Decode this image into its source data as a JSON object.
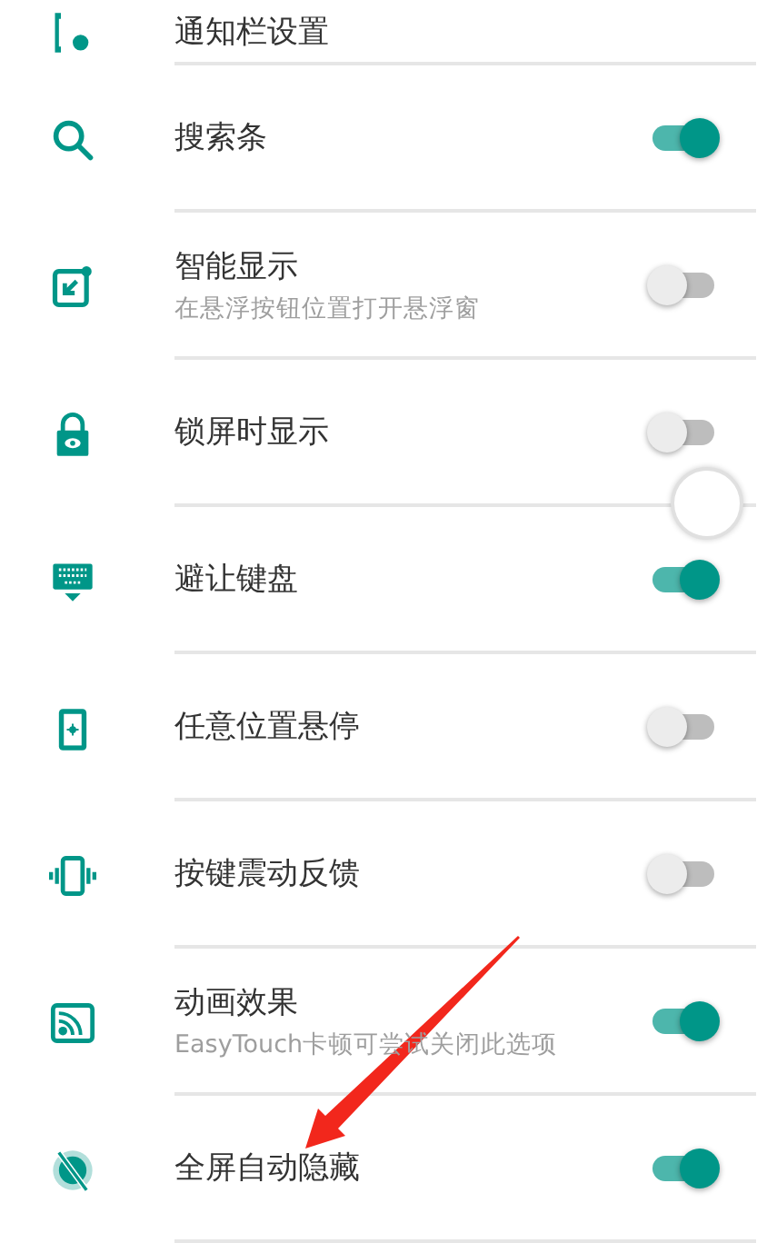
{
  "settings": [
    {
      "kind": "nav",
      "title": "通知栏设置"
    },
    {
      "kind": "toggle",
      "title": "搜索条",
      "on": true
    },
    {
      "kind": "toggle",
      "title": "智能显示",
      "subtitle": "在悬浮按钮位置打开悬浮窗",
      "on": false
    },
    {
      "kind": "toggle",
      "title": "锁屏时显示",
      "on": false
    },
    {
      "kind": "toggle",
      "title": "避让键盘",
      "on": true
    },
    {
      "kind": "toggle",
      "title": "任意位置悬停",
      "on": false
    },
    {
      "kind": "toggle",
      "title": "按键震动反馈",
      "on": false
    },
    {
      "kind": "toggle",
      "title": "动画效果",
      "subtitle": "EasyTouch卡顿可尝试关闭此选项",
      "on": true
    },
    {
      "kind": "toggle",
      "title": "全屏自动隐藏",
      "on": true
    }
  ]
}
